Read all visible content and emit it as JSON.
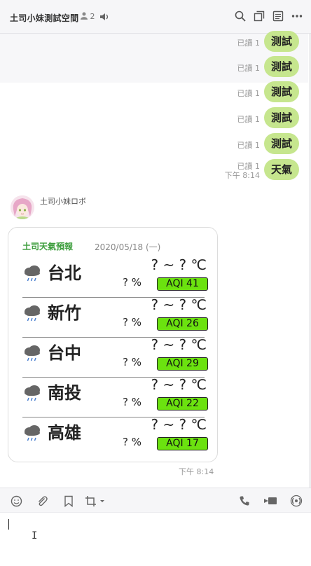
{
  "header": {
    "title": "土司小妹測試空間",
    "member_count": "2",
    "icons": [
      "person-icon",
      "speaker-icon",
      "search-icon",
      "copy-icon",
      "notes-icon",
      "more-icon"
    ]
  },
  "messages": [
    {
      "read": "已讀 1",
      "time": "",
      "text": "測試"
    },
    {
      "read": "已讀 1",
      "time": "",
      "text": "測試"
    },
    {
      "read": "已讀 1",
      "time": "",
      "text": "測試"
    },
    {
      "read": "已讀 1",
      "time": "",
      "text": "測試"
    },
    {
      "read": "已讀 1",
      "time": "",
      "text": "測試"
    },
    {
      "read": "已讀 1",
      "time": "下午 8:14",
      "text": "天氣"
    }
  ],
  "bot": {
    "name": "土司小妹ロボ",
    "time": "下午 8:14"
  },
  "weather_card": {
    "title": "土司天氣預報",
    "date": "2020/05/18 (一)",
    "cities": [
      {
        "name": "台北",
        "temp": "? ~ ? ℃",
        "pop": "? %",
        "aqi": "AQI 41"
      },
      {
        "name": "新竹",
        "temp": "? ~ ? ℃",
        "pop": "? %",
        "aqi": "AQI 26"
      },
      {
        "name": "台中",
        "temp": "? ~ ? ℃",
        "pop": "? %",
        "aqi": "AQI 29"
      },
      {
        "name": "南投",
        "temp": "? ~ ? ℃",
        "pop": "? %",
        "aqi": "AQI 22"
      },
      {
        "name": "高雄",
        "temp": "? ~ ? ℃",
        "pop": "? %",
        "aqi": "AQI 17"
      }
    ],
    "aqi_color": "#6be20f"
  },
  "toolbar": {
    "icons": [
      "emoji-icon",
      "attachment-icon",
      "bookmark-icon",
      "crop-icon",
      "phone-icon",
      "video-icon",
      "live-icon"
    ]
  },
  "input": {
    "value": ""
  },
  "colors": {
    "bubble": "#c6e68e",
    "card_title": "#3e9e3e"
  }
}
